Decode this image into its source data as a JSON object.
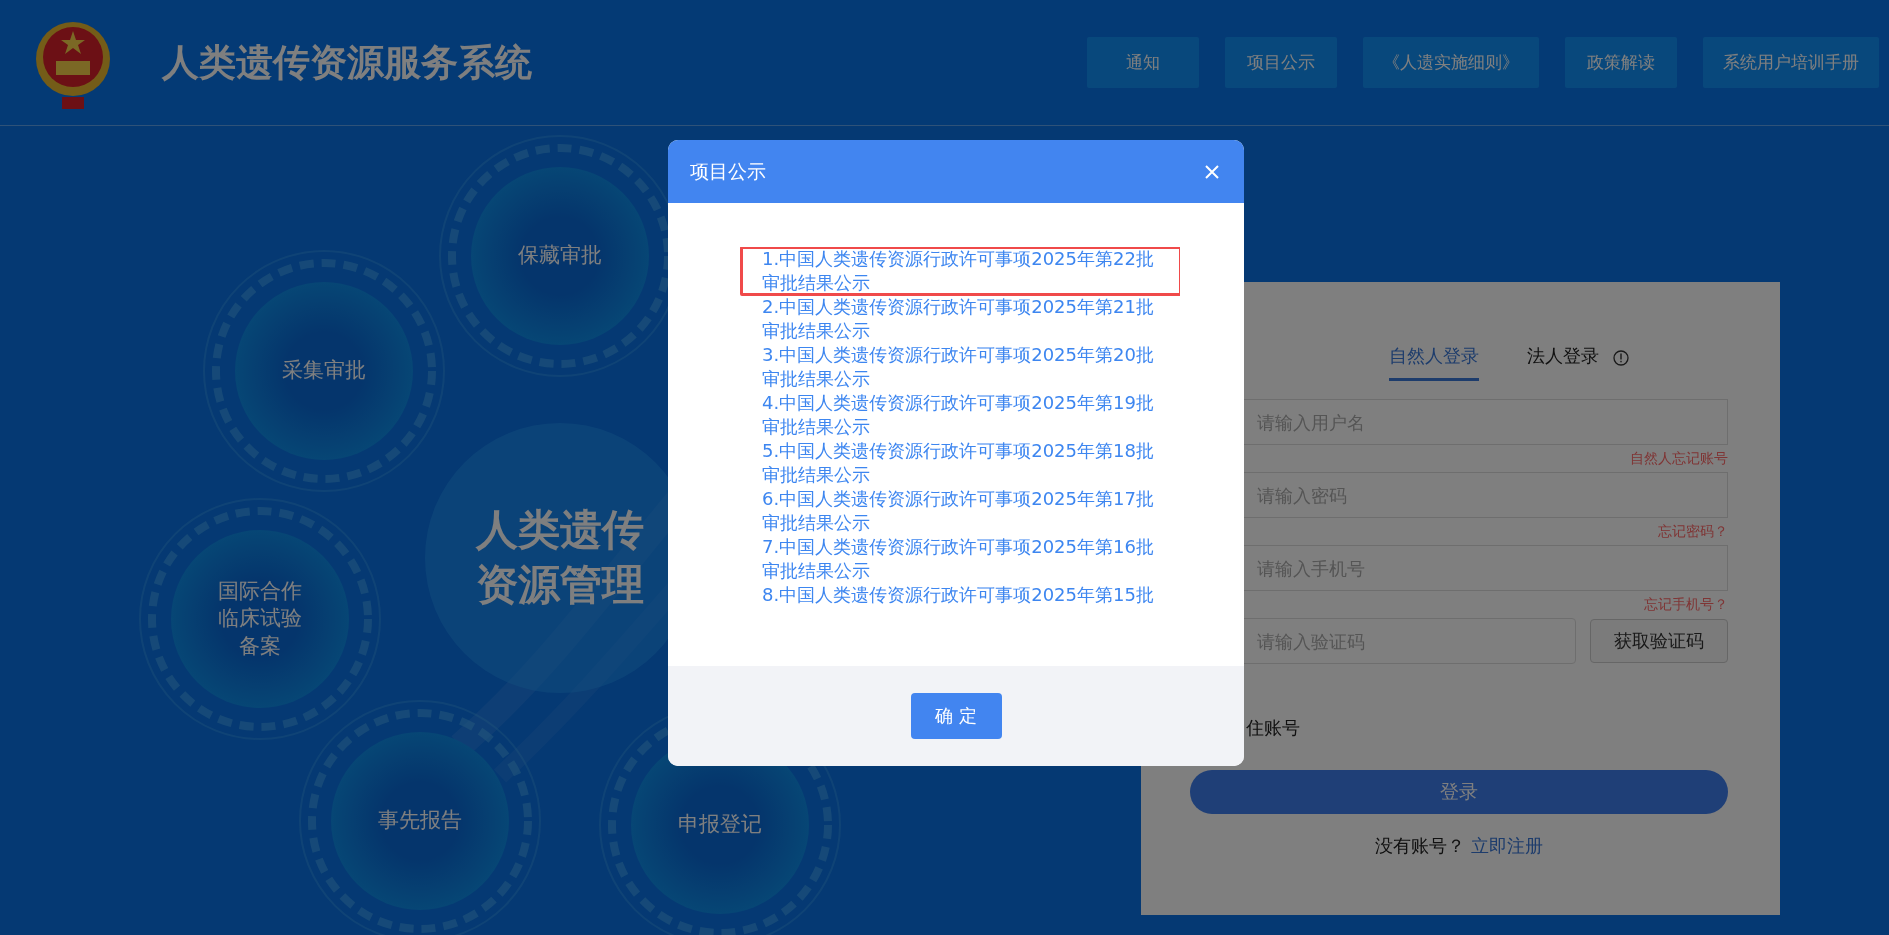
{
  "header": {
    "title": "人类遗传资源服务系统",
    "nav": [
      "通知",
      "项目公示",
      "《人遗实施细则》",
      "政策解读",
      "系统用户培训手册"
    ]
  },
  "hero": {
    "circles": [
      {
        "kind": "ring",
        "lines": [
          "保藏审批"
        ]
      },
      {
        "kind": "ring",
        "lines": [
          "采集审批"
        ]
      },
      {
        "kind": "ring",
        "lines": [
          "国际合作",
          "临床试验",
          "备案"
        ]
      },
      {
        "kind": "ring",
        "lines": [
          "事先报告"
        ]
      },
      {
        "kind": "ring",
        "lines": [
          "申报登记"
        ]
      },
      {
        "kind": "hub",
        "lines": [
          "人类遗传",
          "资源管理"
        ]
      }
    ]
  },
  "login": {
    "tabs": [
      {
        "label": "自然人登录",
        "selected": true
      },
      {
        "label": "法人登录",
        "selected": false
      }
    ],
    "fields": [
      {
        "placeholder": "请输入用户名",
        "link": "自然人忘记账号"
      },
      {
        "placeholder": "请输入密码",
        "link": "忘记密码？"
      },
      {
        "placeholder": "请输入手机号",
        "link": "忘记手机号？"
      }
    ],
    "code": {
      "placeholder": "请输入验证码",
      "button": "获取验证码"
    },
    "remember": "住账号",
    "submit": "登录",
    "register_prompt": "没有账号？",
    "register_link": "立即注册"
  },
  "dialog": {
    "title": "项目公示",
    "items": [
      {
        "text": "1.中国人类遗传资源行政许可事项2025年第22批审批结果公示",
        "highlighted": true
      },
      {
        "text": "2.中国人类遗传资源行政许可事项2025年第21批审批结果公示",
        "highlighted": false
      },
      {
        "text": "3.中国人类遗传资源行政许可事项2025年第20批审批结果公示",
        "highlighted": false
      },
      {
        "text": "4.中国人类遗传资源行政许可事项2025年第19批审批结果公示",
        "highlighted": false
      },
      {
        "text": "5.中国人类遗传资源行政许可事项2025年第18批审批结果公示",
        "highlighted": false
      },
      {
        "text": "6.中国人类遗传资源行政许可事项2025年第17批审批结果公示",
        "highlighted": false
      },
      {
        "text": "7.中国人类遗传资源行政许可事项2025年第16批审批结果公示",
        "highlighted": false
      },
      {
        "text": "8.中国人类遗传资源行政许可事项2025年第15批",
        "highlighted": false
      }
    ],
    "confirm": "确 定"
  }
}
